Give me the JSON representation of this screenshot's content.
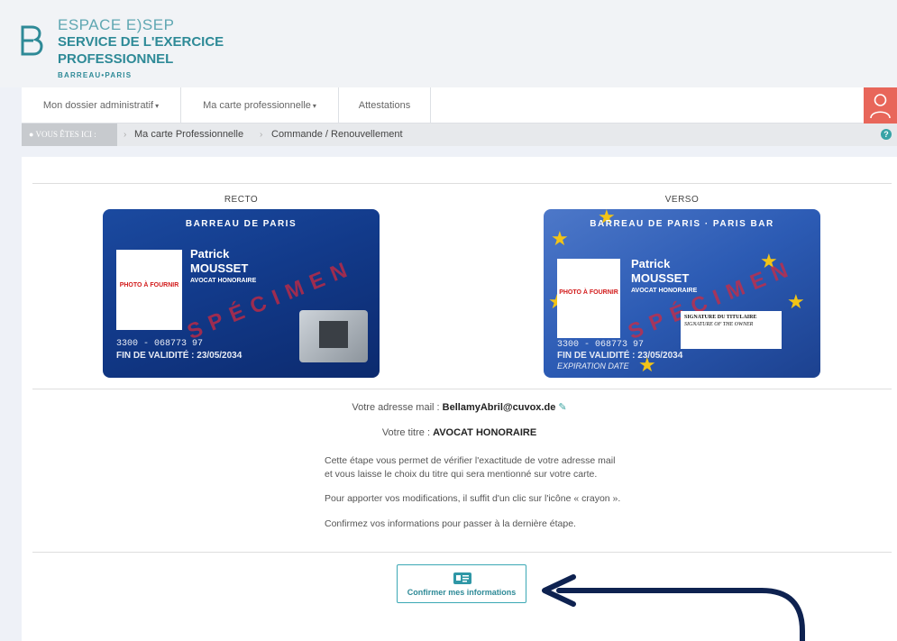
{
  "brand": {
    "top": "ESPACE E)SEP",
    "main": "SERVICE DE L'EXERCICE PROFESSIONNEL",
    "sub": "BARREAU•PARIS"
  },
  "nav": {
    "items": [
      {
        "label": "Mon dossier administratif"
      },
      {
        "label": "Ma carte professionnelle"
      },
      {
        "label": "Attestations"
      }
    ]
  },
  "breadcrumb": {
    "here": "VOUS ÊTES ICI :",
    "items": [
      "Ma carte Professionnelle",
      "Commande / Renouvellement"
    ]
  },
  "cards": {
    "recto_label": "RECTO",
    "verso_label": "VERSO",
    "recto_header": "BARREAU DE PARIS",
    "verso_header": "BARREAU DE PARIS · PARIS BAR",
    "first_name": "Patrick",
    "last_name": "MOUSSET",
    "role": "AVOCAT HONORAIRE",
    "photo": "PHOTO À FOURNIR",
    "number": "3300 - 068773 97",
    "validity": "FIN DE VALIDITÉ : 23/05/2034",
    "expiration": "EXPIRATION DATE",
    "specimen": "SPÉCIMEN",
    "signature": "SIGNATURE DU TITULAIRE",
    "signature_en": "SIGNATURE OF THE OWNER"
  },
  "info": {
    "email_label": "Votre adresse mail :",
    "email": "BellamyAbril@cuvox.de",
    "title_label": "Votre titre :",
    "title": "AVOCAT HONORAIRE",
    "para1_line1": "Cette étape vous permet de vérifier l'exactitude de votre adresse mail",
    "para1_line2": "et vous laisse le choix du titre qui sera mentionné sur votre carte.",
    "para2": "Pour apporter vos modifications, il suffit d'un clic sur l'icône « crayon ».",
    "para3": "Confirmez vos informations pour passer à la dernière étape."
  },
  "confirm": {
    "label": "Confirmer mes informations"
  },
  "colors": {
    "accent": "#2e8a97",
    "user": "#e8665a",
    "arrow": "#0e2250"
  }
}
